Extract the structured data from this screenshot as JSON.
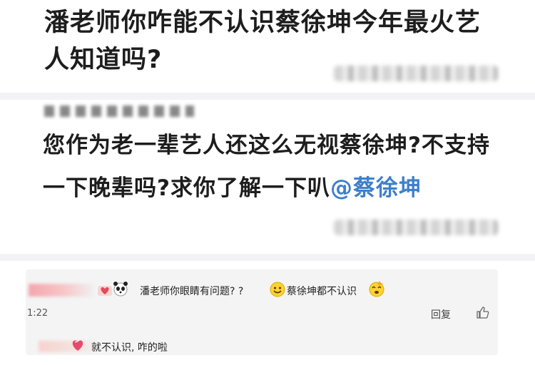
{
  "post1": {
    "text": "潘老师你咋能不认识蔡徐坤今年最火艺人知道吗?"
  },
  "post2": {
    "text_before_mention": "您作为老一辈艺人还这么无视蔡徐坤?不支持一下晚辈吗?求你了解一下叭",
    "mention": "@蔡徐坤"
  },
  "comments": [
    {
      "text_part1": "潘老师你眼睛有问题? ?",
      "text_part2": "蔡徐坤都不认识",
      "time": "1:22",
      "reply_label": "回复",
      "icons": [
        "heart-badge-icon",
        "panda-icon",
        "smile-emoji-icon",
        "dizzy-emoji-icon",
        "like-icon"
      ]
    },
    {
      "text": "就不认识, 咋的啦",
      "icons": [
        "heart-emoji-icon"
      ]
    }
  ],
  "colors": {
    "post_text": "#1d1d1d",
    "mention": "#3e7fcb",
    "comment_bg": "#f4f4f4",
    "separator": "#f3f3f5"
  }
}
